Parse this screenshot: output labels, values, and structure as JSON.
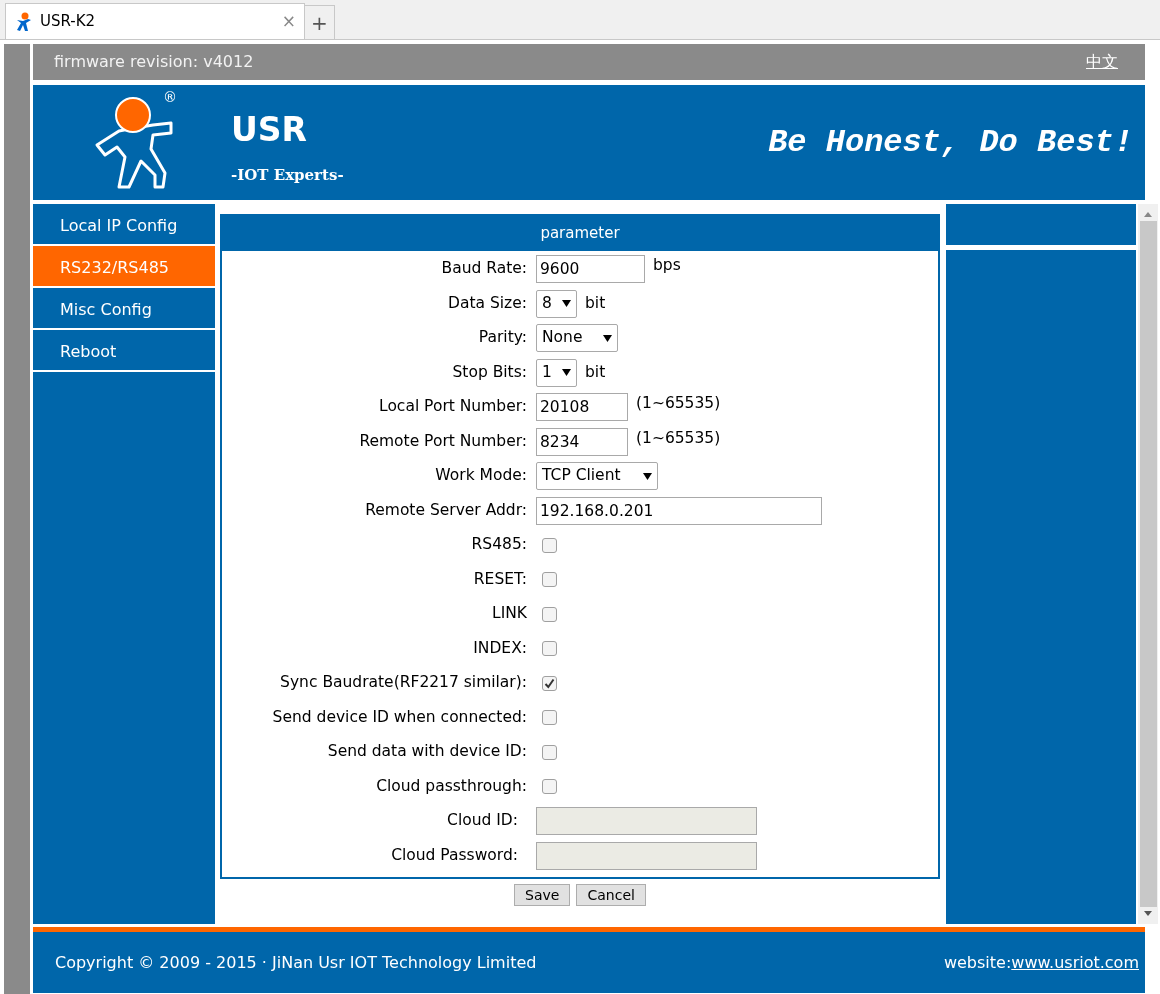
{
  "browser_tab": {
    "title": "USR-K2",
    "close": "×",
    "new_tab": "+"
  },
  "top_bar": {
    "firmware": "firmware revision:  v4012",
    "language_link": "中文"
  },
  "header": {
    "brand": "USR",
    "tagline": "-IOT Experts-",
    "registered_mark": "®",
    "slogan": "Be Honest, Do Best!"
  },
  "sidebar": {
    "items": [
      {
        "label": "Local IP Config",
        "selected": false
      },
      {
        "label": "RS232/RS485",
        "selected": true
      },
      {
        "label": "Misc Config",
        "selected": false
      },
      {
        "label": "Reboot",
        "selected": false
      }
    ]
  },
  "panel": {
    "title": "parameter",
    "fields": [
      {
        "kind": "text",
        "label": "Baud Rate:",
        "value": "9600",
        "unit": "bps"
      },
      {
        "kind": "select",
        "label": "Data Size:",
        "value": "8",
        "unit": "bit"
      },
      {
        "kind": "select",
        "label": "Parity:",
        "value": "None"
      },
      {
        "kind": "select",
        "label": "Stop Bits:",
        "value": "1",
        "unit": "bit"
      },
      {
        "kind": "text",
        "label": "Local Port Number:",
        "value": "20108",
        "unit": "(1~65535)"
      },
      {
        "kind": "text",
        "label": "Remote Port Number:",
        "value": "8234",
        "unit": "(1~65535)"
      },
      {
        "kind": "select",
        "label": "Work Mode:",
        "value": "TCP Client"
      },
      {
        "kind": "text",
        "label": "Remote Server Addr:",
        "value": "192.168.0.201"
      },
      {
        "kind": "checkbox",
        "label": "RS485:",
        "checked": false
      },
      {
        "kind": "checkbox",
        "label": "RESET:",
        "checked": false
      },
      {
        "kind": "checkbox",
        "label": "LINK",
        "checked": false
      },
      {
        "kind": "checkbox",
        "label": "INDEX:",
        "checked": false
      },
      {
        "kind": "checkbox",
        "label": "Sync Baudrate(RF2217 similar):",
        "checked": true
      },
      {
        "kind": "checkbox",
        "label": "Send device ID when connected:",
        "checked": false
      },
      {
        "kind": "checkbox",
        "label": "Send data with device ID:",
        "checked": false
      },
      {
        "kind": "checkbox",
        "label": "Cloud passthrough:",
        "checked": false
      },
      {
        "kind": "text",
        "label": "Cloud ID:",
        "disabled": true
      },
      {
        "kind": "text",
        "label": "Cloud Password:",
        "disabled": true
      }
    ],
    "buttons": [
      "Save",
      "Cancel"
    ]
  },
  "footer": {
    "copyright": "Copyright © 2009 - 2015 · JiNan Usr IOT Technology Limited",
    "website_label": "website:",
    "website_link": "www.usriot.com"
  }
}
